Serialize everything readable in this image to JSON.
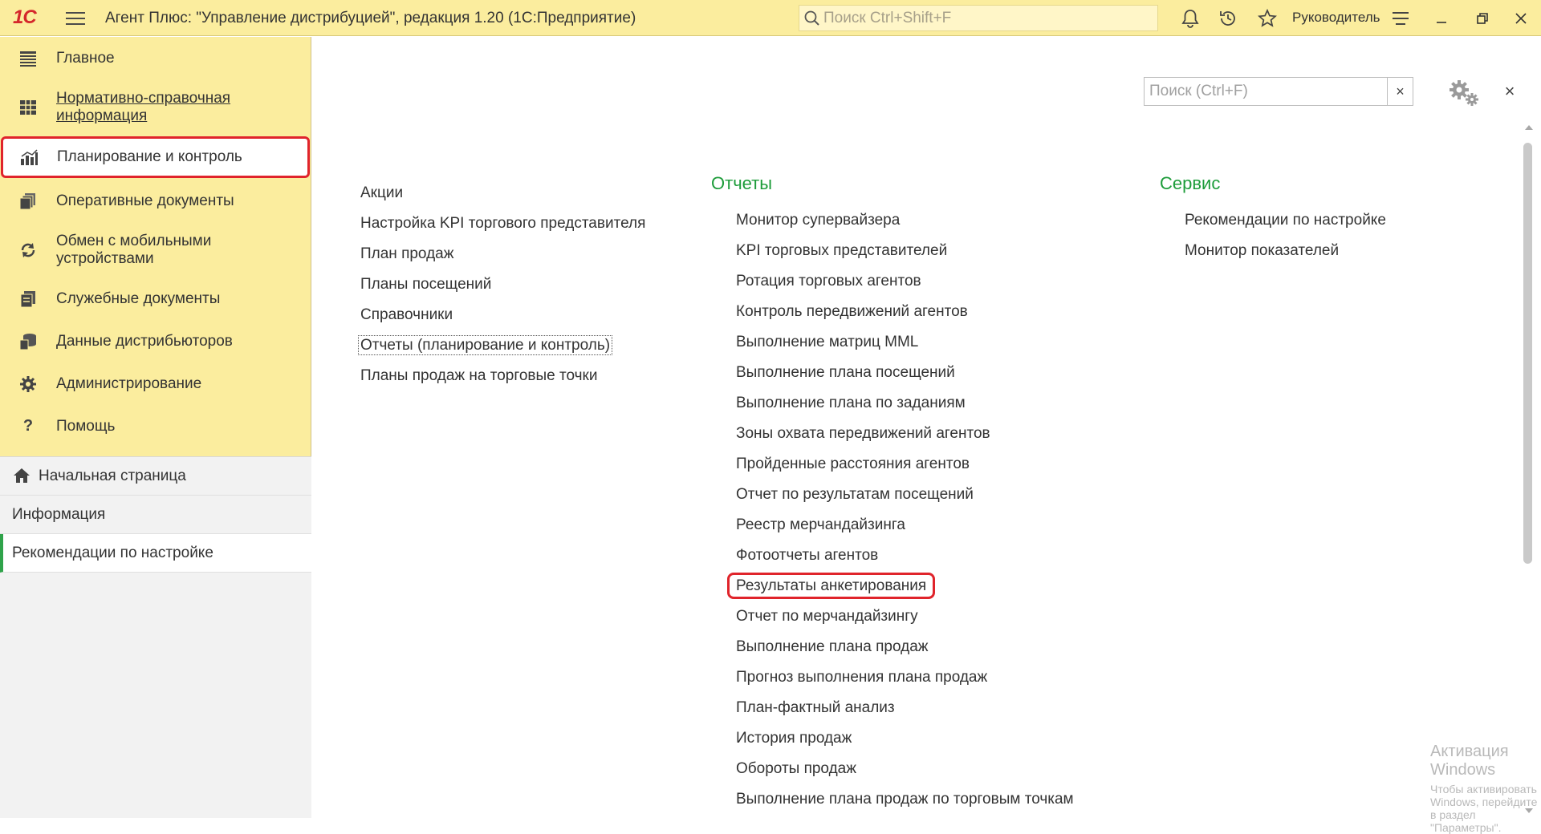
{
  "titlebar": {
    "logo_text": "1С",
    "title": "Агент Плюс: \"Управление дистрибуцией\", редакция 1.20  (1С:Предприятие)",
    "search_placeholder": "Поиск Ctrl+Shift+F",
    "user_name": "Руководитель",
    "icons": [
      "menu-icon",
      "bell-icon",
      "history-icon",
      "star-icon",
      "settings-lines-icon",
      "minimize-icon",
      "restore-icon",
      "close-icon"
    ],
    "background_color": "#fbed9e"
  },
  "sidebar": {
    "sections": [
      {
        "label": "Главное",
        "icon": "list-icon"
      },
      {
        "label": "Нормативно-справочная информация",
        "icon": "table-icon"
      },
      {
        "label": "Планирование и контроль",
        "icon": "bar-chart-icon"
      },
      {
        "label": "Оперативные документы",
        "icon": "documents-icon"
      },
      {
        "label": "Обмен с мобильными устройствами",
        "icon": "sync-icon"
      },
      {
        "label": "Служебные документы",
        "icon": "service-docs-icon"
      },
      {
        "label": "Данные дистрибьюторов",
        "icon": "database-icon"
      },
      {
        "label": "Администрирование",
        "icon": "gear-icon"
      },
      {
        "label": "Помощь",
        "icon": "question-icon"
      }
    ],
    "nav": [
      {
        "label": "Начальная страница",
        "icon": "home-icon"
      },
      {
        "label": "Информация"
      },
      {
        "label": "Рекомендации по настройке"
      }
    ]
  },
  "content": {
    "search_placeholder": "Поиск (Ctrl+F)",
    "clear_label": "×",
    "close_label": "×",
    "left_commands": [
      "Акции",
      "Настройка KPI торгового представителя",
      "План продаж",
      "Планы посещений",
      "Справочники",
      "Отчеты (планирование и контроль)",
      "Планы продаж на торговые точки"
    ],
    "reports": {
      "title": "Отчеты",
      "items": [
        "Монитор супервайзера",
        "KPI торговых представителей",
        "Ротация торговых агентов",
        "Контроль передвижений агентов",
        "Выполнение матриц MML",
        "Выполнение плана посещений",
        "Выполнение плана по заданиям",
        "Зоны охвата передвижений агентов",
        "Пройденные расстояния агентов",
        "Отчет по результатам посещений",
        "Реестр мерчандайзинга",
        "Фотоотчеты агентов",
        "Результаты анкетирования",
        "Отчет по  мерчандайзингу",
        "Выполнение плана продаж",
        "Прогноз выполнения плана продаж",
        "План-фактный анализ",
        "История продаж",
        "Обороты продаж",
        "Выполнение плана продаж по торговым точкам"
      ]
    },
    "service": {
      "title": "Сервис",
      "items": [
        "Рекомендации по настройке",
        "Монитор показателей"
      ]
    },
    "accent_color": "#1d9c3a",
    "highlight_color": "#e0242b"
  },
  "watermark": {
    "line1": "Активация Windows",
    "line2": "Чтобы активировать Windows, перейдите в раздел \"Параметры\"."
  }
}
